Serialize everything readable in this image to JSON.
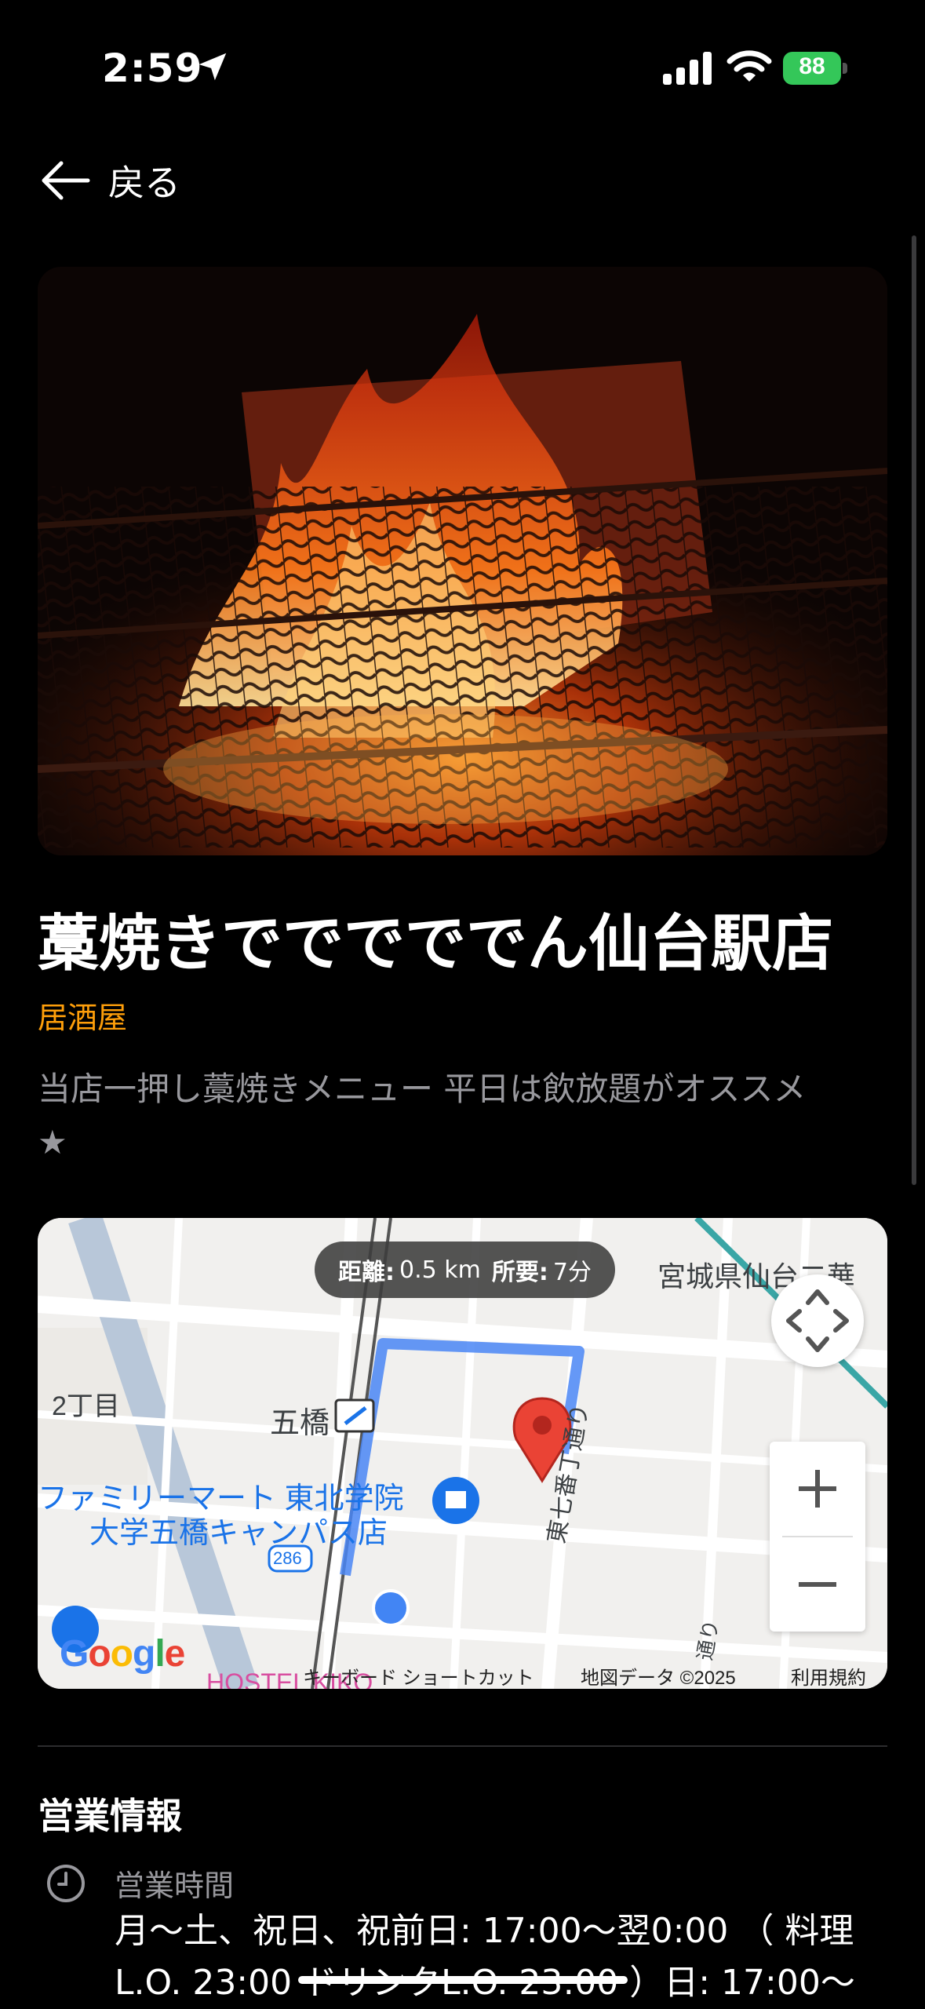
{
  "status_bar": {
    "time": "2:59",
    "battery": "88"
  },
  "nav": {
    "back_label": "戻る"
  },
  "store": {
    "name": "藁焼きでででででん仙台駅店",
    "category": "居酒屋",
    "description": "当店一押し藁焼きメニュー 平日は飲放題がオススメ★"
  },
  "map": {
    "distance_label": "距離:",
    "distance_value": "0.5 km",
    "duration_label": "所要:",
    "duration_value": "7分",
    "labels": {
      "area_2chome": "2丁目",
      "station": "五橋",
      "familymart_line1": "ファミリーマート 東北学院",
      "familymart_line2": "大学五橋キャンパス店",
      "route_286": "286",
      "pref_office": "宮城県仙台二華",
      "street": "東七番丁通り",
      "street2": "通り",
      "hostel": "HOSTEL KIKO"
    },
    "attribution": {
      "shortcuts": "キーボード ショートカット",
      "data": "地図データ ©2025",
      "terms": "利用規約"
    },
    "logo": "Google"
  },
  "info": {
    "section_title": "営業情報",
    "hours_label": "営業時間",
    "hours_value": "月～土、祝日、祝前日: 17:00～翌0:00 （ 料理L.O. 23:00 ドリンクL.O. 23:00 ）日: 17:00～"
  },
  "colors": {
    "accent": "#ff9f0a",
    "muted": "#98989d",
    "route": "#4285f4",
    "pin": "#ea4335"
  }
}
